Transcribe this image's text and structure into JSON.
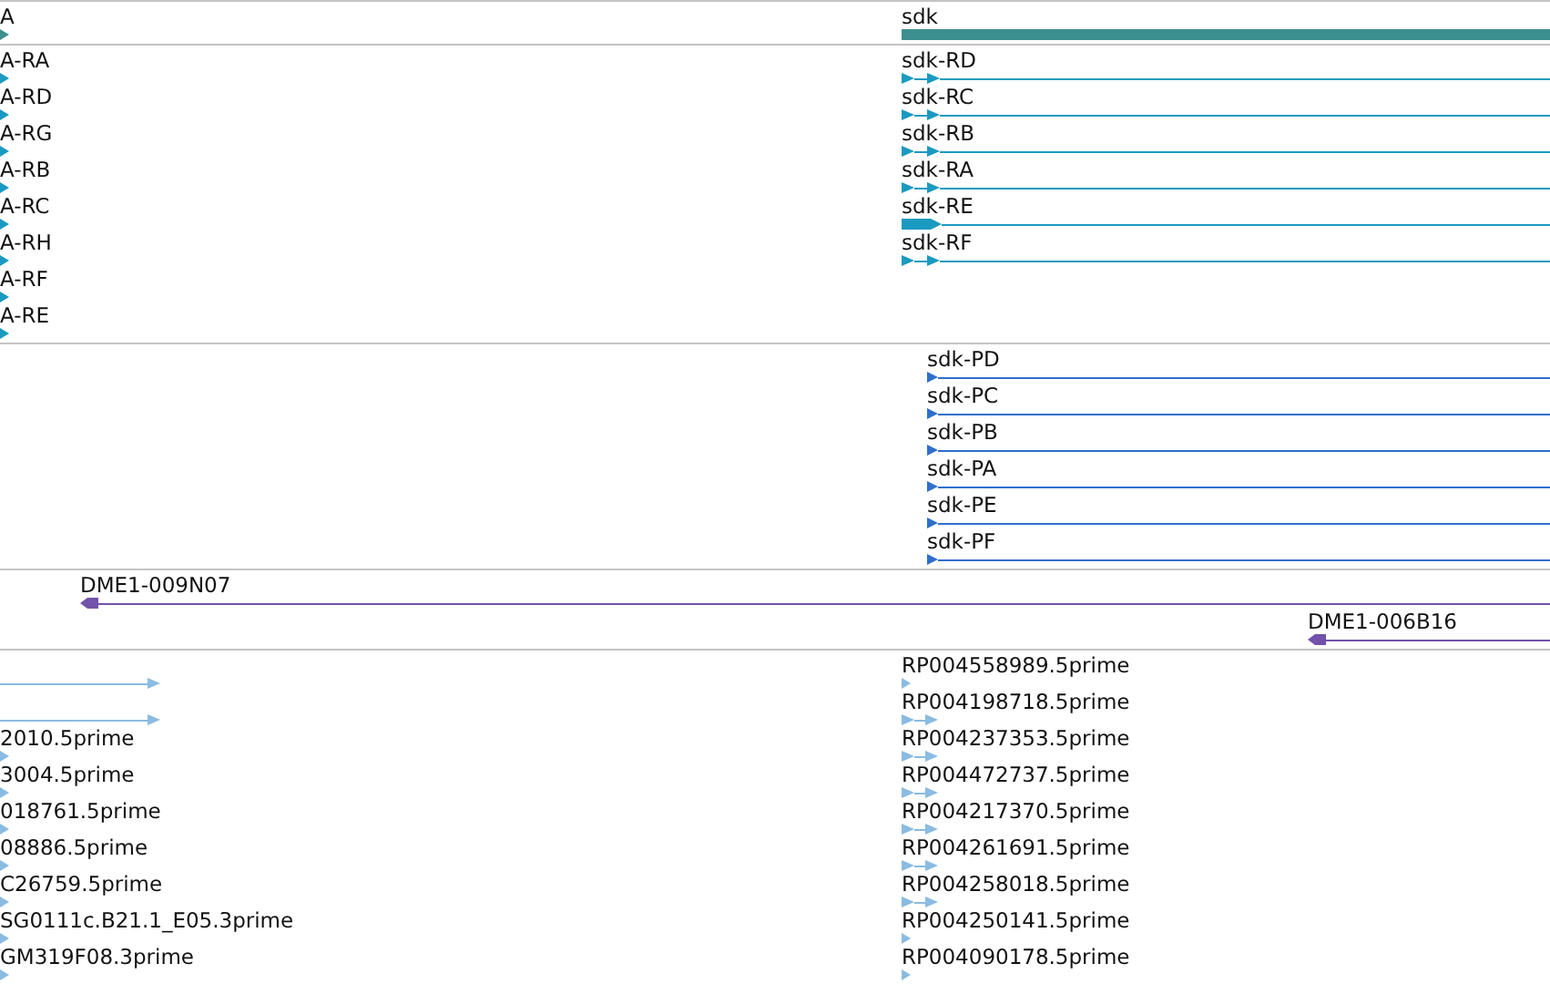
{
  "tracks": [
    {
      "kind": "gene",
      "rows": [
        {
          "left": {
            "label": "A",
            "kind": "tick"
          },
          "right": {
            "label": "sdk",
            "kind": "bar"
          }
        }
      ]
    },
    {
      "kind": "transcript",
      "rows": [
        {
          "left": {
            "label": "A-RA",
            "kind": "tick"
          },
          "right": {
            "label": "sdk-RD",
            "kind": "line"
          }
        },
        {
          "left": {
            "label": "A-RD",
            "kind": "tick"
          },
          "right": {
            "label": "sdk-RC",
            "kind": "line"
          }
        },
        {
          "left": {
            "label": "A-RG",
            "kind": "tick"
          },
          "right": {
            "label": "sdk-RB",
            "kind": "line"
          }
        },
        {
          "left": {
            "label": "A-RB",
            "kind": "tick"
          },
          "right": {
            "label": "sdk-RA",
            "kind": "line"
          }
        },
        {
          "left": {
            "label": "A-RC",
            "kind": "tick"
          },
          "right": {
            "label": "sdk-RE",
            "kind": "thickline"
          }
        },
        {
          "left": {
            "label": "A-RH",
            "kind": "tick"
          },
          "right": {
            "label": "sdk-RF",
            "kind": "line"
          }
        },
        {
          "left": {
            "label": "A-RF",
            "kind": "tick"
          }
        },
        {
          "left": {
            "label": "A-RE",
            "kind": "tick"
          }
        }
      ]
    },
    {
      "kind": "protein",
      "rows": [
        {
          "right": {
            "label": "sdk-PD",
            "kind": "pline"
          }
        },
        {
          "right": {
            "label": "sdk-PC",
            "kind": "pline"
          }
        },
        {
          "right": {
            "label": "sdk-PB",
            "kind": "pline"
          }
        },
        {
          "right": {
            "label": "sdk-PA",
            "kind": "pline"
          }
        },
        {
          "right": {
            "label": "sdk-PE",
            "kind": "pline"
          }
        },
        {
          "right": {
            "label": "sdk-PF",
            "kind": "pline"
          }
        }
      ]
    },
    {
      "kind": "clone",
      "rows": [
        {
          "left": {
            "label": "DME1-009N07",
            "kind": "reverse"
          }
        },
        {
          "right": {
            "label": "DME1-006B16",
            "kind": "reverse"
          }
        }
      ]
    },
    {
      "kind": "est",
      "rows": [
        {
          "left": {
            "kind": "short"
          },
          "right": {
            "label": "RP004558989.5prime",
            "kind": "point"
          }
        },
        {
          "left": {
            "kind": "short"
          },
          "right": {
            "label": "RP004198718.5prime",
            "kind": "pair"
          }
        },
        {
          "left": {
            "label": "2010.5prime",
            "kind": "point"
          },
          "right": {
            "label": "RP004237353.5prime",
            "kind": "pair"
          }
        },
        {
          "left": {
            "label": "3004.5prime",
            "kind": "point"
          },
          "right": {
            "label": "RP004472737.5prime",
            "kind": "pair"
          }
        },
        {
          "left": {
            "label": "018761.5prime",
            "kind": "point"
          },
          "right": {
            "label": "RP004217370.5prime",
            "kind": "pair"
          }
        },
        {
          "left": {
            "label": "08886.5prime",
            "kind": "point"
          },
          "right": {
            "label": "RP004261691.5prime",
            "kind": "pair"
          }
        },
        {
          "left": {
            "label": "C26759.5prime",
            "kind": "point"
          },
          "right": {
            "label": "RP004258018.5prime",
            "kind": "pair"
          }
        },
        {
          "left": {
            "label": "SG0111c.B21.1_E05.3prime",
            "kind": "point"
          },
          "right": {
            "label": "RP004250141.5prime",
            "kind": "point"
          }
        },
        {
          "left": {
            "label": "GM319F08.3prime",
            "kind": "point"
          },
          "right": {
            "label": "RP004090178.5prime",
            "kind": "point"
          }
        }
      ]
    }
  ]
}
